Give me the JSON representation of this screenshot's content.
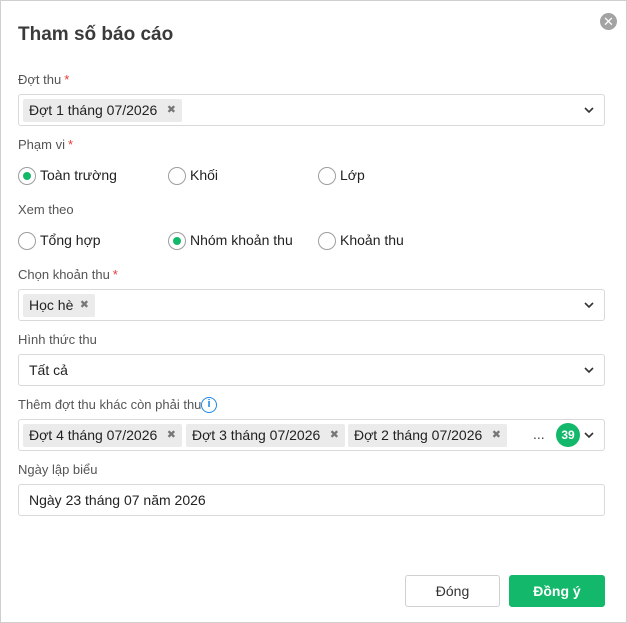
{
  "dialog": {
    "title": "Tham số báo cáo",
    "close_symbol": "✕"
  },
  "dot_thu": {
    "label": "Đợt thu",
    "required_mark": "*",
    "tags": [
      "Đợt 1 tháng 07/2026"
    ]
  },
  "pham_vi": {
    "label": "Phạm vi",
    "required_mark": "*",
    "options": [
      {
        "label": "Toàn trường",
        "selected": true
      },
      {
        "label": "Khối",
        "selected": false
      },
      {
        "label": "Lớp",
        "selected": false
      }
    ]
  },
  "xem_theo": {
    "label": "Xem theo",
    "options": [
      {
        "label": "Tổng hợp",
        "selected": false
      },
      {
        "label": "Nhóm khoản thu",
        "selected": true
      },
      {
        "label": "Khoản thu",
        "selected": false
      }
    ]
  },
  "chon_khoan_thu": {
    "label": "Chọn khoản thu",
    "required_mark": "*",
    "tags": [
      "Học hè"
    ]
  },
  "hinh_thuc_thu": {
    "label": "Hình thức thu",
    "value": "Tất cả"
  },
  "them_dot_thu": {
    "label": "Thêm đợt thu khác còn phải thu",
    "info_symbol": "i",
    "tags": [
      "Đợt 4 tháng 07/2026",
      "Đợt 3 tháng 07/2026",
      "Đợt 2 tháng 07/2026"
    ],
    "more_indicator": "...",
    "count": "39"
  },
  "ngay_lap_bieu": {
    "label": "Ngày lập biểu",
    "value": "Ngày 23 tháng 07 năm 2026"
  },
  "buttons": {
    "close_label": "Đóng",
    "ok_label": "Đồng ý"
  },
  "icons": {
    "close": "close-icon",
    "chevron": "chevron-down-icon",
    "tag_remove": "x-icon",
    "info": "info-icon"
  },
  "colors": {
    "accent": "#14b86a",
    "required": "#e53935",
    "info": "#1e88e5"
  }
}
